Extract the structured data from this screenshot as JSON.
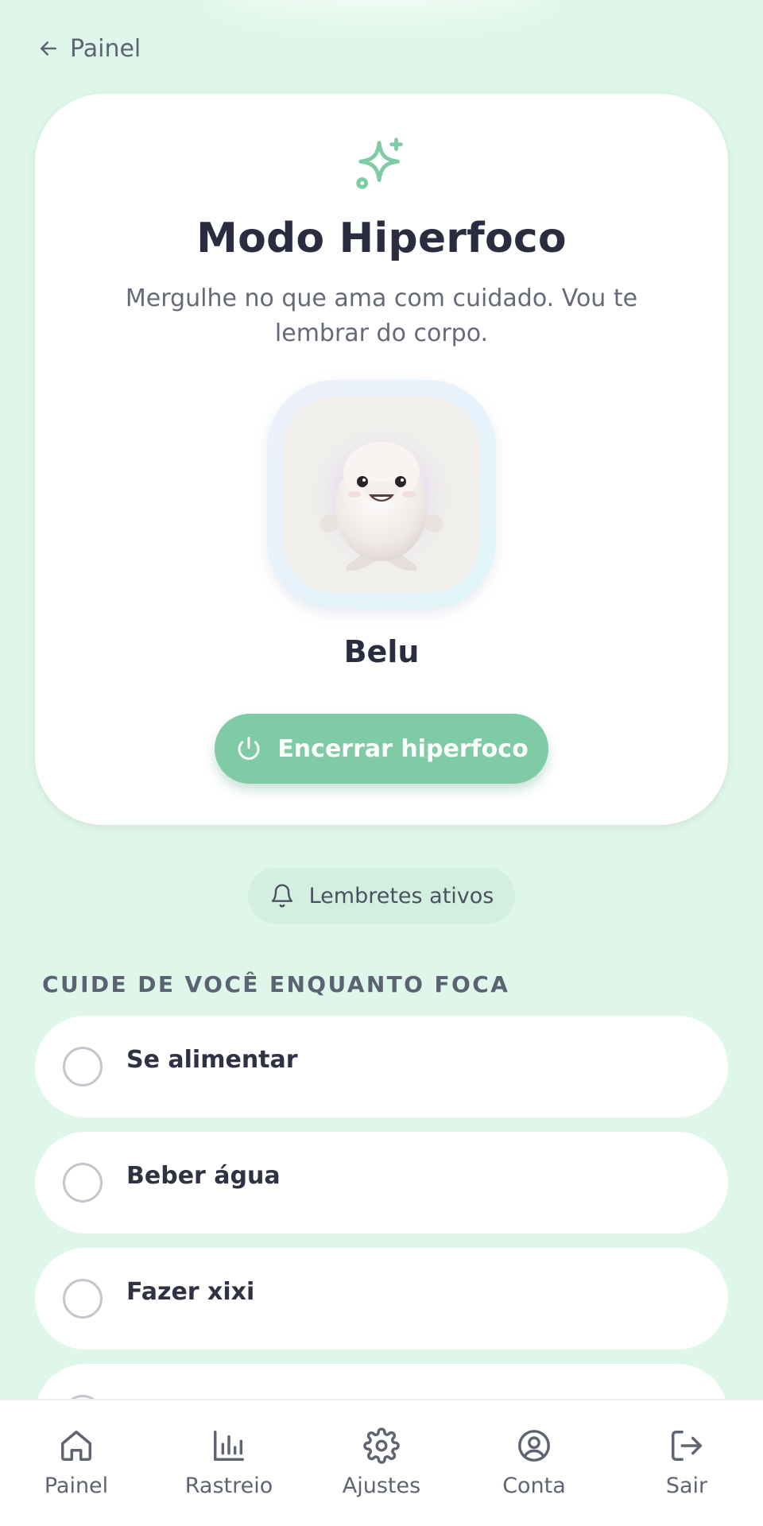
{
  "header": {
    "back_label": "Painel",
    "back_icon": "arrow-left-icon"
  },
  "hero": {
    "icon": "sparkles-icon",
    "title": "Modo Hiperfoco",
    "subtitle": "Mergulhe no que ama com cuidado. Vou te lembrar do corpo.",
    "pet_name": "Belu",
    "end_button_label": "Encerrar hiperfoco",
    "end_button_icon": "power-icon"
  },
  "reminders": {
    "label": "Lembretes ativos",
    "icon": "bell-icon"
  },
  "care_section": {
    "title": "CUIDE DE VOCÊ ENQUANTO FOCA",
    "items": [
      {
        "label": "Se alimentar",
        "checked": false
      },
      {
        "label": "Beber água",
        "checked": false
      },
      {
        "label": "Fazer xixi",
        "checked": false
      }
    ]
  },
  "bottom_nav": {
    "items": [
      {
        "label": "Painel",
        "icon": "home-icon"
      },
      {
        "label": "Rastreio",
        "icon": "bar-chart-icon"
      },
      {
        "label": "Ajustes",
        "icon": "gear-icon"
      },
      {
        "label": "Conta",
        "icon": "user-circle-icon"
      },
      {
        "label": "Sair",
        "icon": "logout-icon"
      }
    ]
  },
  "colors": {
    "background": "#dff7ea",
    "accent": "#7ecba5",
    "card": "#ffffff",
    "text": "#2a2c40"
  }
}
